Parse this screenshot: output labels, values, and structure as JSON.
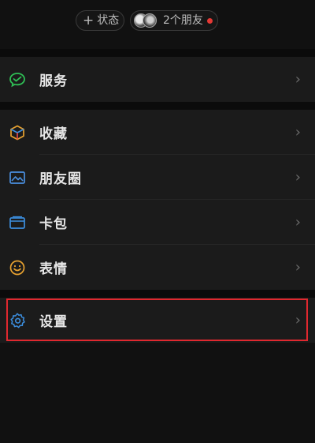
{
  "status_bar": {
    "status_button": {
      "icon": "plus-icon",
      "label": "状态"
    },
    "friends_button": {
      "label": "2个朋友",
      "badge_color": "#e53935"
    }
  },
  "menu": {
    "items": [
      {
        "label": "服务",
        "icon": "wechat-pay-icon",
        "icon_color": "#2fbf55"
      },
      {
        "label": "收藏",
        "icon": "favorites-cube-icon",
        "icon_color": "#e8a230"
      },
      {
        "label": "朋友圈",
        "icon": "moments-image-icon",
        "icon_color": "#4a8fe0"
      },
      {
        "label": "卡包",
        "icon": "card-wallet-icon",
        "icon_color": "#3c8fe0"
      },
      {
        "label": "表情",
        "icon": "emoji-smile-icon",
        "icon_color": "#e8a230"
      },
      {
        "label": "设置",
        "icon": "settings-gear-icon",
        "icon_color": "#3c8fe0"
      }
    ],
    "chevron": "›"
  },
  "highlight": {
    "target": "设置",
    "color": "#e0282f"
  }
}
